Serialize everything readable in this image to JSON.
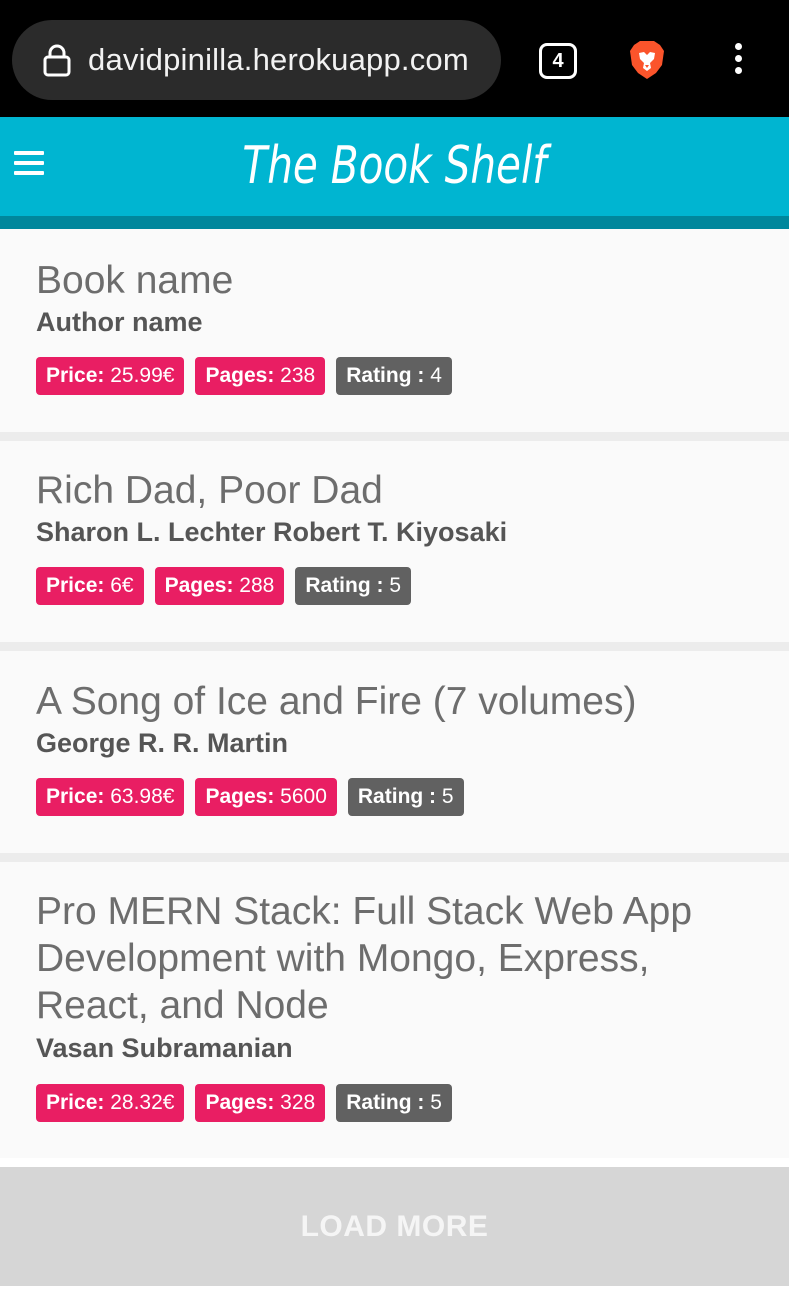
{
  "browser": {
    "url": "davidpinilla.herokuapp.com",
    "tab_count": "4",
    "icons": {
      "lock": "lock-icon",
      "brave": "brave-lion-icon",
      "menu": "more-vert-icon"
    }
  },
  "header": {
    "title": "The Book Shelf",
    "menu_icon": "hamburger-icon",
    "color": "#00b5d1"
  },
  "labels": {
    "price": "Price:",
    "pages": "Pages:",
    "rating": "Rating :"
  },
  "books": [
    {
      "title": "Book name",
      "author": "Author name",
      "price": "25.99€",
      "pages": "238",
      "rating": "4"
    },
    {
      "title": "Rich Dad, Poor Dad",
      "author": "Sharon L. Lechter Robert T. Kiyosaki",
      "price": "6€",
      "pages": "288",
      "rating": "5"
    },
    {
      "title": "A Song of Ice and Fire (7 volumes)",
      "author": "George R. R. Martin",
      "price": "63.98€",
      "pages": "5600",
      "rating": "5"
    },
    {
      "title": "Pro MERN Stack: Full Stack Web App Development with Mongo, Express, React, and Node",
      "author": "Vasan Subramanian",
      "price": "28.32€",
      "pages": "328",
      "rating": "5"
    }
  ],
  "load_more": {
    "label": "LOAD MORE"
  },
  "colors": {
    "accent_badge": "#e91e63",
    "rating_badge": "#616161",
    "load_more_bg": "#d6d6d6"
  }
}
